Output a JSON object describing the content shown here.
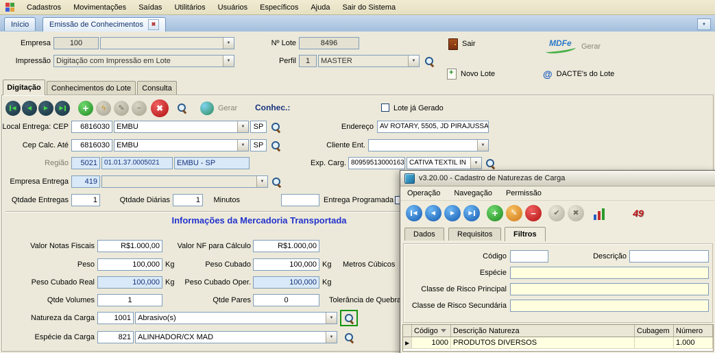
{
  "menubar": {
    "items": [
      "Cadastros",
      "Movimentações",
      "Saídas",
      "Utilitários",
      "Usuários",
      "Específicos",
      "Ajuda",
      "Sair do Sistema"
    ]
  },
  "tabs": {
    "inicio": "Início",
    "emissao": "Emissão de Conhecimentos"
  },
  "header": {
    "empresa_label": "Empresa",
    "empresa_value": "100",
    "nlote_label": "Nº Lote",
    "nlote_value": "8496",
    "impressao_label": "Impressão",
    "impressao_value": "Digitação com Impressão em Lote",
    "perfil_label": "Perfil",
    "perfil_num": "1",
    "perfil_value": "MASTER",
    "sair": "Sair",
    "novo_lote": "Novo Lote",
    "gerar": "Gerar",
    "mdfe_text": "MDFe",
    "dactes": "DACTE's do Lote"
  },
  "subtabs": {
    "digitacao": "Digitação",
    "conhecimentos": "Conhecimentos do Lote",
    "consulta": "Consulta"
  },
  "toolbar": {
    "gerar": "Gerar",
    "conhec": "Conhec.:",
    "lote_gerado": "Lote já Gerado"
  },
  "entrega": {
    "local_label": "Local Entrega: CEP",
    "local_cep": "6816030",
    "local_cidade": "EMBU",
    "local_uf": "SP",
    "endereco_label": "Endereço",
    "endereco_value": "AV ROTARY, 5505, JD PIRAJUSSARA",
    "cep_calc_label": "Cep Calc. Até",
    "cep_calc_value": "6816030",
    "cep_calc_cidade": "EMBU",
    "cep_calc_uf": "SP",
    "cliente_label": "Cliente Ent.",
    "regiao_label": "Região",
    "regiao_cod": "5021",
    "regiao_ref": "01.01.37.0005021",
    "regiao_nome": "EMBU - SP",
    "exp_label": "Exp. Carg.",
    "exp_cnpj": "80959513000163",
    "exp_nome": "CATIVA TEXTIL IN",
    "empresa_entrega_label": "Empresa Entrega",
    "empresa_entrega_value": "419",
    "qtd_entregas_label": "Qtdade Entregas",
    "qtd_entregas_value": "1",
    "qtd_diarias_label": "Qtdade Diárias",
    "qtd_diarias_value": "1",
    "minutos_label": "Minutos",
    "programada_label": "Entrega Programada"
  },
  "mercadoria": {
    "title": "Informações da Mercadoria Transportada",
    "valor_nf_label": "Valor Notas Fiscais",
    "valor_nf_value": "R$1.000,00",
    "valor_calc_label": "Valor NF para Cálculo",
    "valor_calc_value": "R$1.000,00",
    "peso_label": "Peso",
    "peso_value": "100,000",
    "peso_cubado_label": "Peso Cubado",
    "peso_cubado_value": "100,000",
    "metros_label": "Metros Cúbicos",
    "peso_real_label": "Peso Cubado Real",
    "peso_real_value": "100,000",
    "peso_oper_label": "Peso Cubado Oper.",
    "peso_oper_value": "100,000",
    "kg": "Kg",
    "volumes_label": "Qtde Volumes",
    "volumes_value": "1",
    "pares_label": "Qtde Pares",
    "pares_value": "0",
    "tolerancia_label": "Tolerância de Quebra",
    "natureza_label": "Natureza da Carga",
    "natureza_cod": "1001",
    "natureza_value": "Abrasivo(s)",
    "especie_label": "Espécie da Carga",
    "especie_cod": "821",
    "especie_value": "ALINHADOR/CX MAD"
  },
  "dialog": {
    "title": "v3.20.00 - Cadastro de Naturezas de Carga",
    "menu": {
      "operacao": "Operação",
      "navegacao": "Navegação",
      "permissao": "Permissão"
    },
    "tabs": {
      "dados": "Dados",
      "requisitos": "Requisitos",
      "filtros": "Filtros"
    },
    "fields": {
      "codigo": "Código",
      "descricao": "Descrição",
      "especie": "Espécie",
      "classe1": "Classe de Risco Principal",
      "classe2": "Classe de Risco Secundária"
    },
    "badge": "49",
    "grid": {
      "headers": [
        "Código",
        "Descrição Natureza",
        "Cubagem",
        "Número"
      ],
      "row": {
        "codigo": "1000",
        "descricao": "PRODUTOS DIVERSOS",
        "cubagem": "",
        "numero": "1.000"
      }
    }
  },
  "icons": {
    "dropdown": "▼",
    "prev": "◀",
    "next": "▶",
    "add": "+",
    "remove": "−",
    "edit": "✎",
    "cancel": "✖",
    "confirm": "✔",
    "lightning": "ϟ",
    "close": "✖",
    "at": "@",
    "row_marker": "▶"
  }
}
